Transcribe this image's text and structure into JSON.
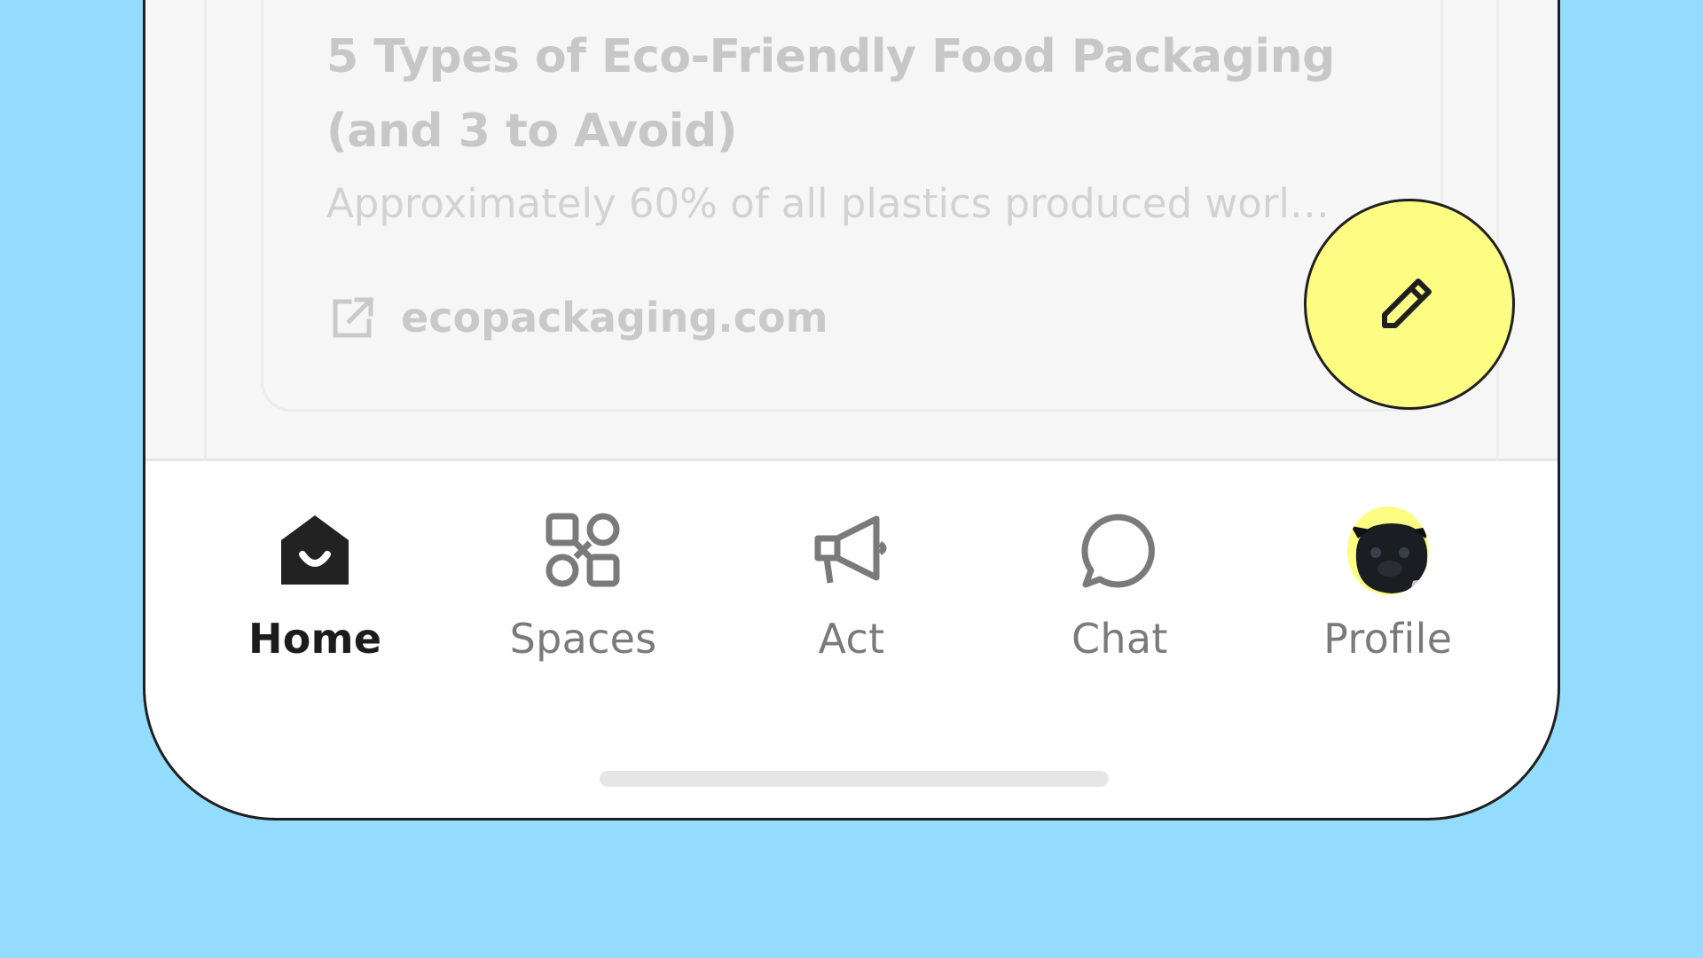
{
  "card": {
    "title_line1": "5 Types of Eco-Friendly Food Packaging",
    "title_line2": "(and 3 to Avoid)",
    "description": "Approximately 60% of all plastics produced world...",
    "link_icon": "external-link-icon",
    "domain": "ecopackaging.com"
  },
  "fab": {
    "icon": "pencil-icon"
  },
  "tabs": [
    {
      "label": "Home",
      "icon": "home-icon",
      "active": true
    },
    {
      "label": "Spaces",
      "icon": "spaces-icon",
      "active": false
    },
    {
      "label": "Act",
      "icon": "megaphone-icon",
      "active": false
    },
    {
      "label": "Chat",
      "icon": "chat-bubble-icon",
      "active": false
    },
    {
      "label": "Profile",
      "icon": "avatar",
      "active": false
    }
  ],
  "colors": {
    "background": "#94dcfd",
    "fab": "#fdfd83",
    "active_tab": "#1c1c1c",
    "inactive_tab": "#7a7a7a"
  }
}
